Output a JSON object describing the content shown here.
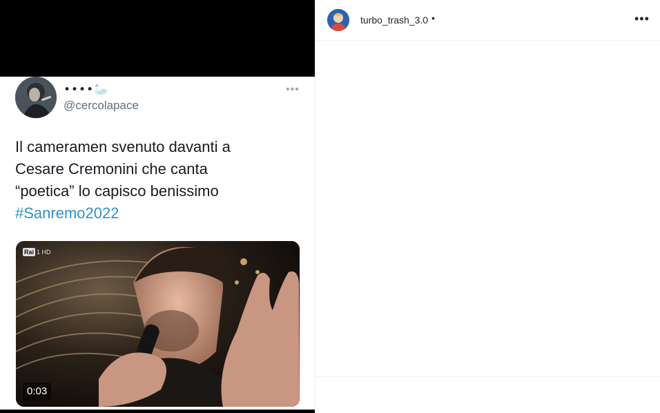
{
  "tweet": {
    "display_name": "••••🦢",
    "handle": "@cercolapace",
    "more_icon": "•••",
    "text_lines": [
      "Il cameramen svenuto davanti a",
      "Cesare Cremonini che canta",
      "“poetica” lo capisco benissimo"
    ],
    "hashtag": "#Sanremo2022",
    "video": {
      "duration": "0:03",
      "channel_logo": "Rai",
      "channel_suffix": "1 HD"
    }
  },
  "post": {
    "username": "turbo_trash_3.0",
    "separator": "•",
    "more_icon": "•••"
  },
  "colors": {
    "hashtag": "#2f92c8",
    "handle": "#5b7083",
    "border": "#efefef"
  }
}
